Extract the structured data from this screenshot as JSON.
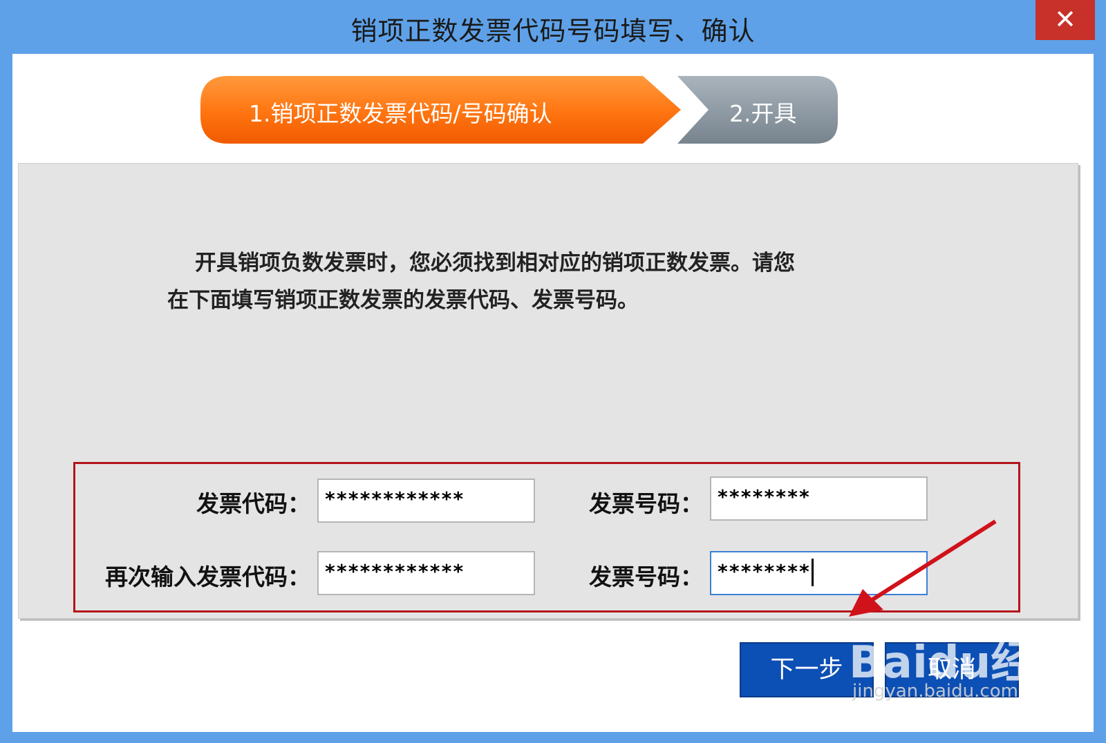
{
  "window": {
    "title": "销项正数发票代码号码填写、确认",
    "close_glyph": "✕"
  },
  "steps": [
    {
      "label": "1.销项正数发票代码/号码确认",
      "state": "active"
    },
    {
      "label": "2.开具",
      "state": "inactive"
    }
  ],
  "instructions": {
    "line1": "开具销项负数发票时，您必须找到相对应的销项正数发票。请您",
    "line2": "在下面填写销项正数发票的发票代码、发票号码。"
  },
  "form": {
    "invoice_code_label": "发票代码：",
    "invoice_code_value": "************",
    "invoice_number_label": "发票号码：",
    "invoice_number_value": "********",
    "confirm_code_label": "再次输入发票代码：",
    "confirm_code_value": "************",
    "confirm_number_label": "发票号码：",
    "confirm_number_value": "********"
  },
  "buttons": {
    "next": "下一步",
    "cancel": "取消"
  },
  "watermark": {
    "brand": "Baidu经验",
    "url": "jingyan.baidu.com"
  },
  "colors": {
    "titlebar": "#5ea1e8",
    "close": "#c8302a",
    "step_active": "#ff7a14",
    "step_inactive": "#8d99a4",
    "button": "#0c4fb5",
    "highlight_frame": "#b3141b"
  },
  "icons": {
    "close": "close-icon",
    "annotation_arrow": "red-arrow-icon"
  }
}
